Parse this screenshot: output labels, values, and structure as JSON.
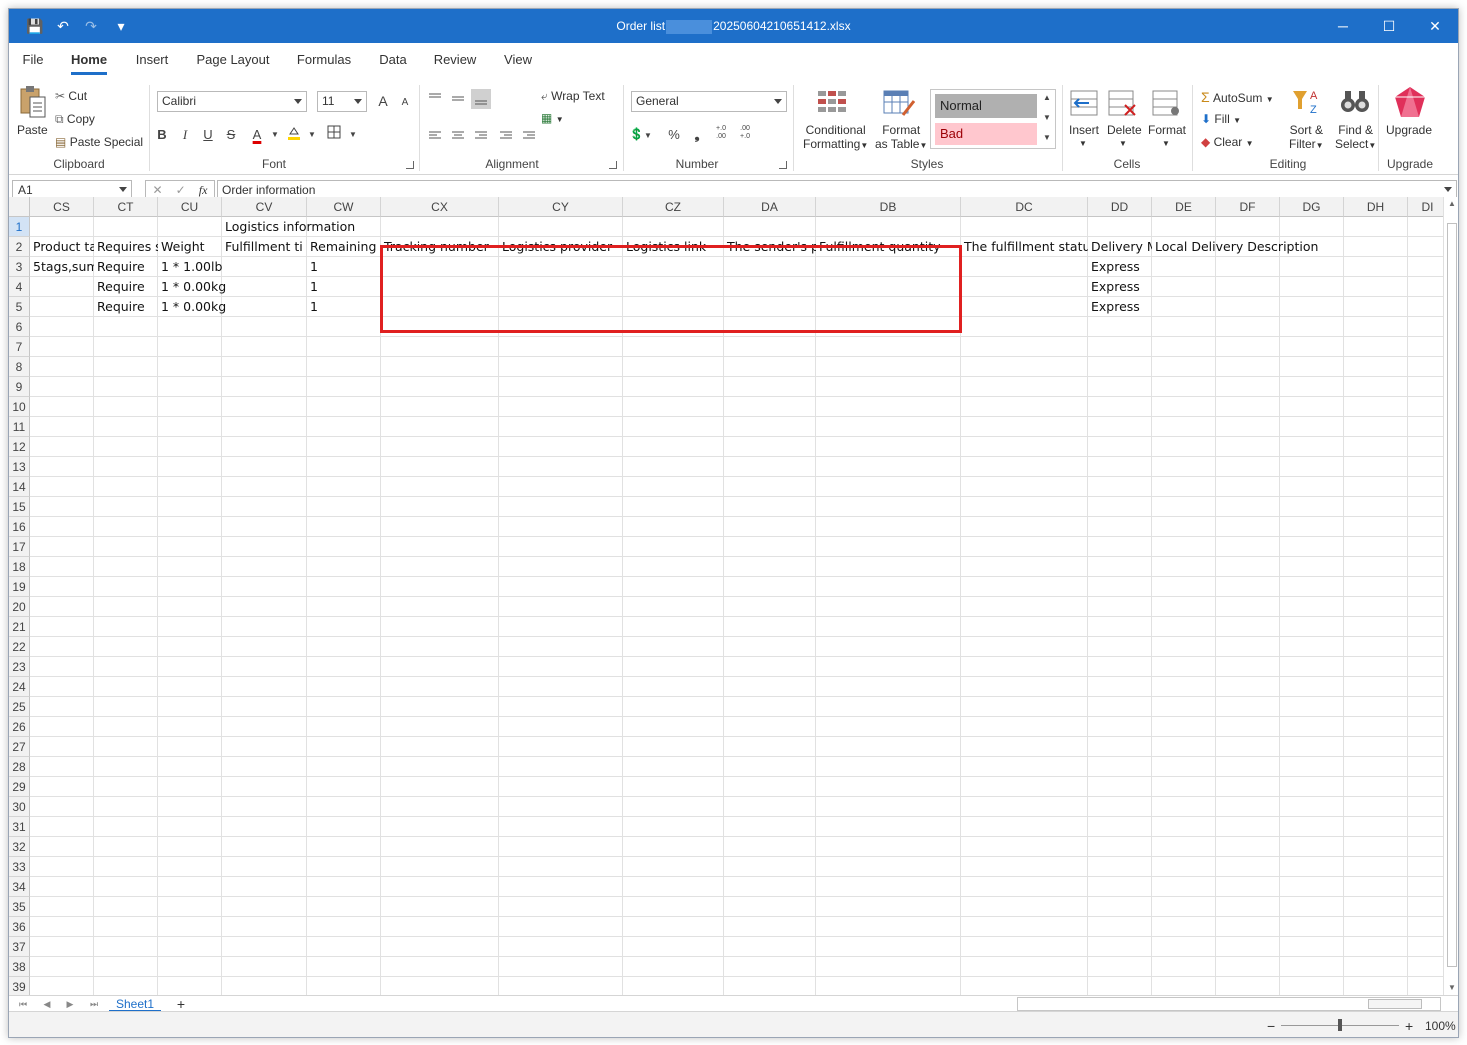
{
  "window": {
    "title_prefix": "Order list",
    "title_suffix": "20250604210651412.xlsx",
    "accent": "#1e6fc9"
  },
  "quick_access": {
    "save": "💾",
    "undo": "↶",
    "redo": "↷",
    "customize": "▾"
  },
  "window_controls": {
    "minimize": "─",
    "maximize": "☐",
    "close": "✕"
  },
  "menu_tabs": [
    "File",
    "Home",
    "Insert",
    "Page Layout",
    "Formulas",
    "Data",
    "Review",
    "View"
  ],
  "ribbon": {
    "clipboard": {
      "label": "Clipboard",
      "paste": "Paste",
      "cut": "Cut",
      "copy": "Copy",
      "paste_special": "Paste Special"
    },
    "font": {
      "label": "Font",
      "family": "Calibri",
      "size": "11",
      "bold": "B",
      "italic": "I",
      "underline": "U",
      "strike": "S",
      "font_color": "A",
      "grow": "A",
      "shrink": "A"
    },
    "alignment": {
      "label": "Alignment",
      "wrap_text": "Wrap Text"
    },
    "number": {
      "label": "Number",
      "format": "General",
      "percent": "%",
      "comma": "❟",
      "inc_dec": "+.0\n.00",
      "dec_dec": ".00\n+.0"
    },
    "styles": {
      "label": "Styles",
      "conditional_line1": "Conditional",
      "conditional_line2": "Formatting",
      "format_table_line1": "Format",
      "format_table_line2": "as Table",
      "normal": "Normal",
      "bad": "Bad"
    },
    "cells": {
      "label": "Cells",
      "insert": "Insert",
      "delete": "Delete",
      "format": "Format"
    },
    "editing": {
      "label": "Editing",
      "autosum": "AutoSum",
      "fill": "Fill",
      "clear": "Clear",
      "sort_line1": "Sort &",
      "sort_line2": "Filter",
      "find_line1": "Find &",
      "find_line2": "Select"
    },
    "upgrade": {
      "label": "Upgrade",
      "button": "Upgrade"
    }
  },
  "formula_bar": {
    "name_box": "A1",
    "cancel": "✕",
    "enter": "✓",
    "fx": "fx",
    "content": "Order information"
  },
  "columns": [
    "CS",
    "CT",
    "CU",
    "CV",
    "CW",
    "CX",
    "CY",
    "CZ",
    "DA",
    "DB",
    "DC",
    "DD",
    "DE",
    "DF",
    "DG",
    "DH",
    "DI"
  ],
  "rows": [
    "1",
    "2",
    "3",
    "4",
    "5",
    "6",
    "7",
    "8",
    "9",
    "10",
    "11",
    "12",
    "13",
    "14",
    "15",
    "16",
    "17",
    "18",
    "19",
    "20",
    "21",
    "22",
    "23",
    "24",
    "25",
    "26",
    "27",
    "28",
    "29",
    "30",
    "31",
    "32",
    "33",
    "34",
    "35",
    "36",
    "37",
    "38",
    "39"
  ],
  "cells": {
    "r1": {
      "CV": "Logistics information"
    },
    "r2": {
      "CS": "Product ta",
      "CT": "Requires s",
      "CU": "Weight",
      "CV": "Fulfillment ti",
      "CW": "Remaining",
      "CX": "Tracking number",
      "CY": "Logistics provider",
      "CZ": "Logistics link",
      "DA": "The sender's p",
      "DB": "Fulfillment quantity",
      "DC": "The fulfillment statu",
      "DD": "Delivery M",
      "DE": "Local Delivery Description"
    },
    "r3": {
      "CS": "5tags,sum",
      "CT": "Require",
      "CU": "1 * 1.00lb",
      "CW": "1",
      "DD": "Express"
    },
    "r4": {
      "CT": "Require",
      "CU": "1 * 0.00kg",
      "CW": "1",
      "DD": "Express"
    },
    "r5": {
      "CT": "Require",
      "CU": "1 * 0.00kg",
      "CW": "1",
      "DD": "Express"
    }
  },
  "sheets": {
    "active": "Sheet1",
    "add": "+"
  },
  "status": {
    "zoom": "100%",
    "minus": "−",
    "plus": "+"
  }
}
